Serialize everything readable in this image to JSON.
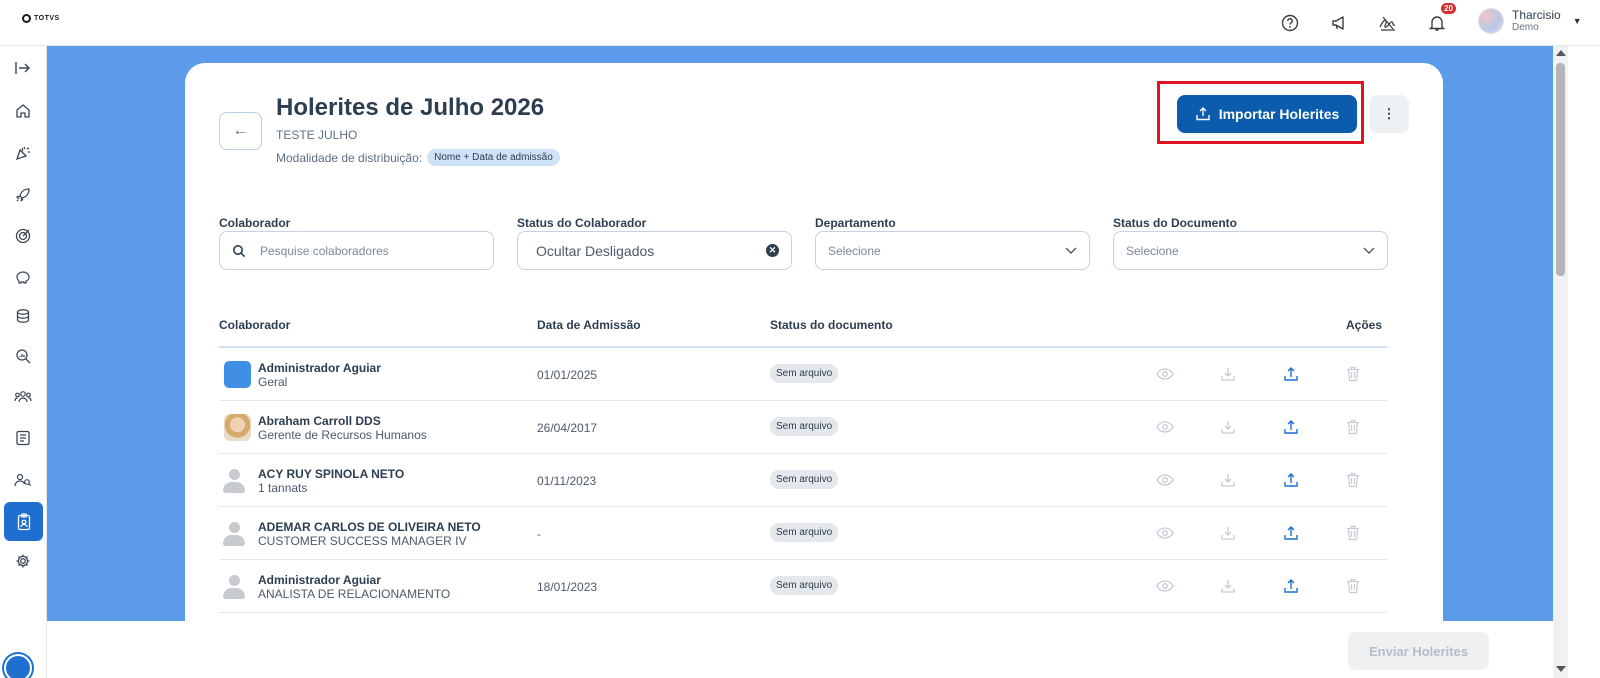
{
  "brand": {
    "logo_text": "TOTVS"
  },
  "header": {
    "notifications_count": "20",
    "user": {
      "name": "Tharcisio",
      "role": "Demo"
    },
    "icons": [
      "help-icon",
      "megaphone-icon",
      "signature-icon",
      "bell-icon"
    ]
  },
  "sidebar": {
    "items": [
      "expand-icon",
      "home-icon",
      "celebration-icon",
      "rocket-icon",
      "target-icon",
      "piggy-bank-icon",
      "database-icon",
      "search-analytics-icon",
      "team-icon",
      "checklist-icon",
      "people-search-icon",
      "payslip-icon",
      "settings-icon"
    ],
    "active": "payslip-icon"
  },
  "page": {
    "title": "Holerites de Julho 2026",
    "subtitle": "TESTE JULHO",
    "modality_label": "Modalidade de distribuição:",
    "modality_value": "Nome + Data de admissão",
    "import_button": "Importar Holerites",
    "more_button": "⋮"
  },
  "filters": {
    "colaborador": {
      "label": "Colaborador",
      "placeholder": "Pesquise colaboradores"
    },
    "status_colaborador": {
      "label": "Status do Colaborador",
      "value": "Ocultar Desligados"
    },
    "departamento": {
      "label": "Departamento",
      "placeholder": "Selecione"
    },
    "status_documento": {
      "label": "Status do Documento",
      "placeholder": "Selecione"
    }
  },
  "table": {
    "headers": {
      "colaborador": "Colaborador",
      "data": "Data de Admissão",
      "status": "Status do documento",
      "acoes": "Ações"
    },
    "rows": [
      {
        "name": "Administrador Aguiar",
        "role": "Geral",
        "date": "01/01/2025",
        "status": "Sem arquivo",
        "avatar": "app"
      },
      {
        "name": "Abraham Carroll DDS",
        "role": "Gerente de Recursos Humanos",
        "date": "26/04/2017",
        "status": "Sem arquivo",
        "avatar": "photo"
      },
      {
        "name": "ACY RUY SPINOLA NETO",
        "role": "1 tannats",
        "date": "01/11/2023",
        "status": "Sem arquivo",
        "avatar": "placeholder"
      },
      {
        "name": "ADEMAR CARLOS DE OLIVEIRA NETO",
        "role": "CUSTOMER SUCCESS MANAGER IV",
        "date": "-",
        "status": "Sem arquivo",
        "avatar": "placeholder"
      },
      {
        "name": "Administrador Aguiar",
        "role": "ANALISTA DE RELACIONAMENTO",
        "date": "18/01/2023",
        "status": "Sem arquivo",
        "avatar": "placeholder"
      }
    ]
  },
  "footer": {
    "send_button": "Enviar Holerites"
  },
  "colors": {
    "accent": "#0b5cad",
    "background": "#5b9bea",
    "highlight": "#e0141e"
  }
}
